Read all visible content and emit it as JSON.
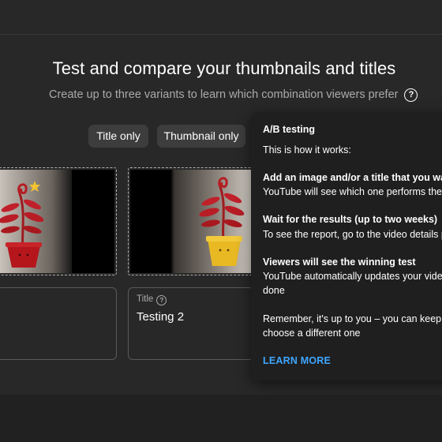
{
  "page": {
    "heading": "Test and compare your thumbnails and titles",
    "subheading": "Create up to three variants to learn which combination viewers prefer",
    "help_icon_glyph": "?"
  },
  "chips": [
    {
      "label": "Title only"
    },
    {
      "label": "Thumbnail only"
    }
  ],
  "thumbnails": [
    {
      "flower_color": "#c0202a",
      "pot_color": "#b5161c",
      "has_star": true
    },
    {
      "flower_color": "#c0202a",
      "pot_color": "#e8b923",
      "has_star": false
    }
  ],
  "fields": [
    {
      "label": "",
      "value": ""
    },
    {
      "label": "Title",
      "value": "Testing 2"
    }
  ],
  "tooltip": {
    "title": "A/B testing",
    "intro": "This is how it works:",
    "step1_title": "Add an image and/or a title that you want t",
    "step1_body": "YouTube will see which one performs the b",
    "step2_title": "Wait for the results (up to two weeks)",
    "step2_body": "To see the report, go to the video details pa",
    "step3_title": "Viewers will see the winning test",
    "step3_body_line1": "YouTube automatically updates your video",
    "step3_body_line2": "done",
    "reminder_line1": "Remember, it's up to you – you can keep the",
    "reminder_line2": "choose a different one",
    "learn_more": "LEARN MORE"
  },
  "colors": {
    "background": "#282828",
    "tooltip_bg": "#1f1f1f",
    "link": "#3ea6ff",
    "muted_text": "#aaaaaa"
  }
}
